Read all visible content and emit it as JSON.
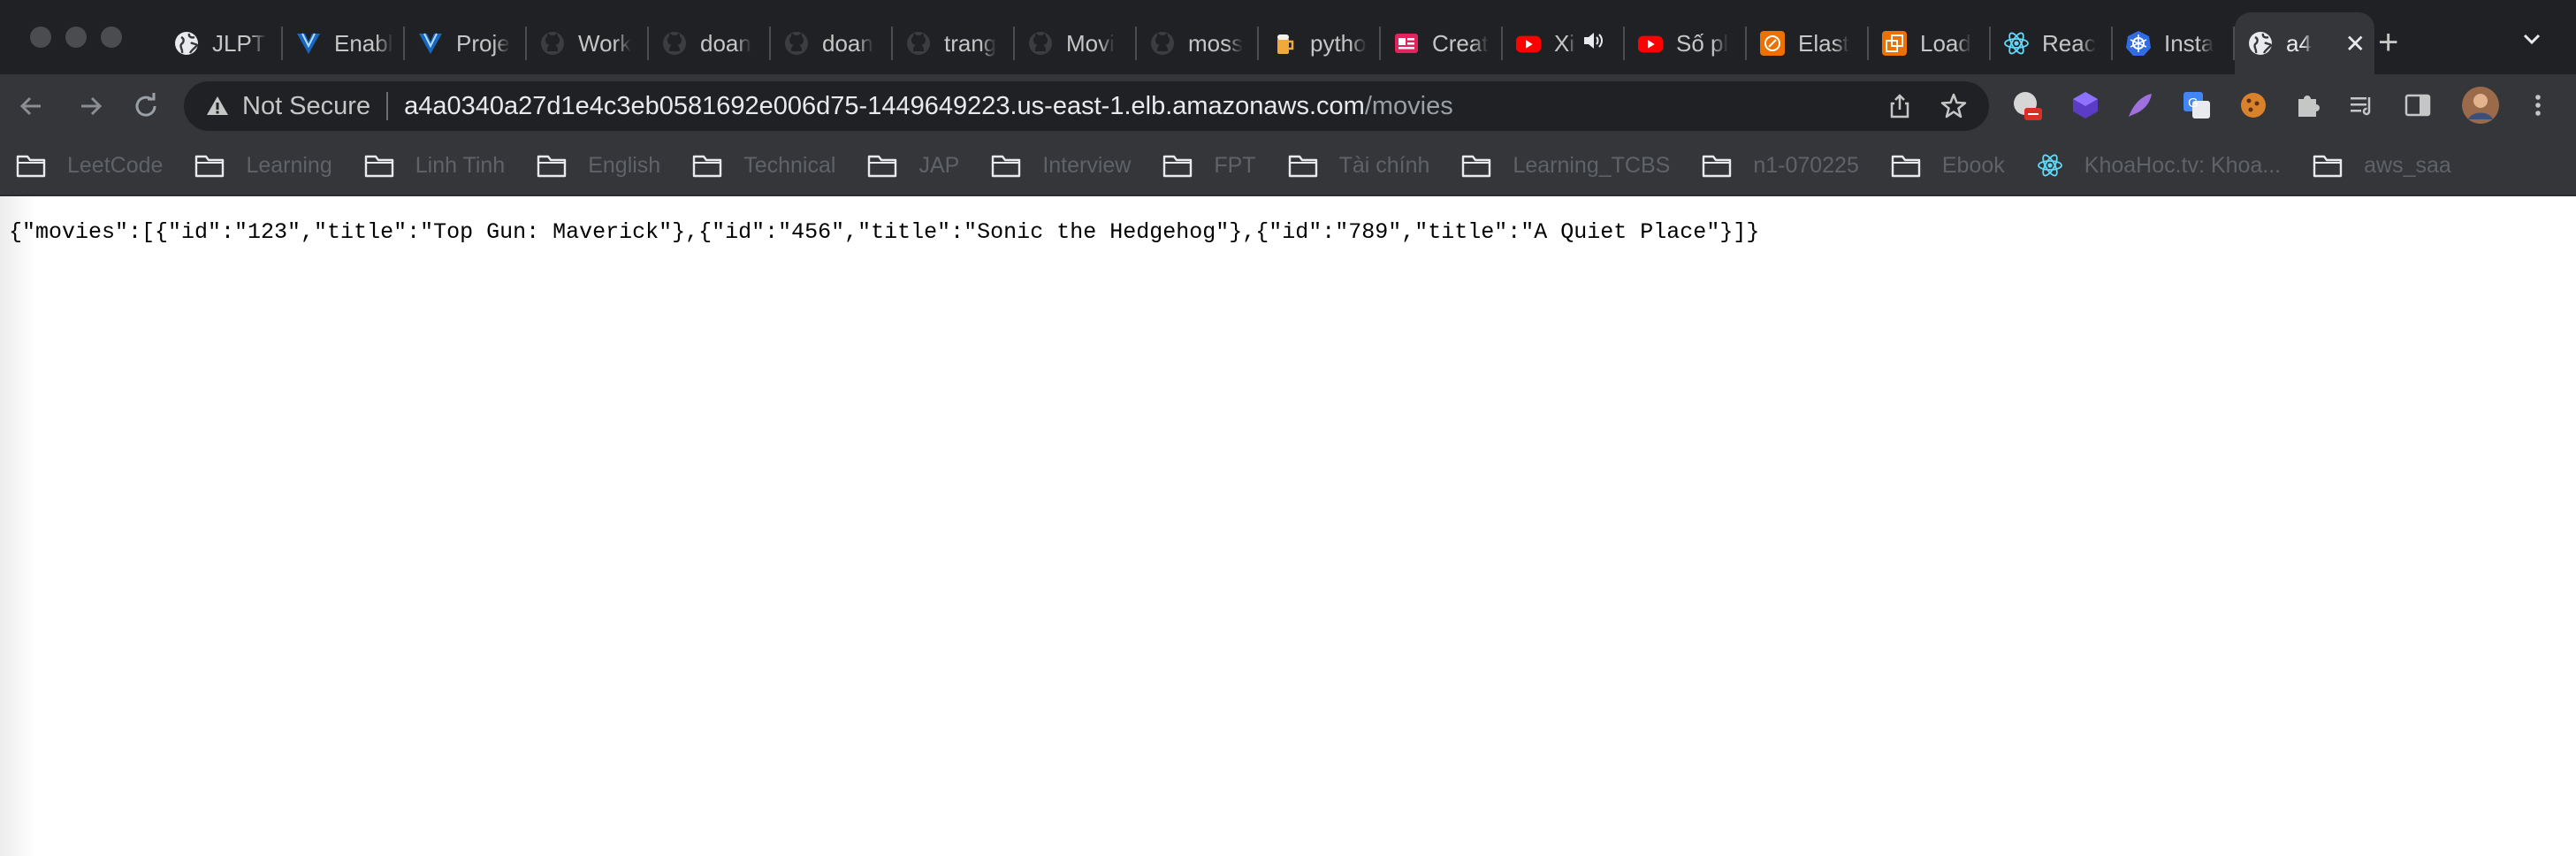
{
  "tabs": [
    {
      "label": "JLPT",
      "icon": "globe-icon"
    },
    {
      "label": "Enabl",
      "icon": "vuetify-icon"
    },
    {
      "label": "Proje",
      "icon": "vuetify-icon"
    },
    {
      "label": "Work",
      "icon": "github-icon"
    },
    {
      "label": "doan",
      "icon": "github-icon"
    },
    {
      "label": "doan",
      "icon": "github-icon"
    },
    {
      "label": "trang",
      "icon": "github-icon"
    },
    {
      "label": "Movi",
      "icon": "github-icon"
    },
    {
      "label": "moss",
      "icon": "github-icon"
    },
    {
      "label": "pytho",
      "icon": "beer-icon"
    },
    {
      "label": "Creat",
      "icon": "form-icon"
    },
    {
      "label": "Xi",
      "icon": "youtube-icon",
      "audio": true
    },
    {
      "label": "Số pl",
      "icon": "youtube-icon"
    },
    {
      "label": "Elast",
      "icon": "aws-elastic-icon"
    },
    {
      "label": "Load",
      "icon": "aws-loadbalancer-icon"
    },
    {
      "label": "Reac",
      "icon": "react-icon"
    },
    {
      "label": "Insta",
      "icon": "kubernetes-icon"
    },
    {
      "label": "a4",
      "icon": "globe-icon",
      "active": true
    }
  ],
  "close_glyph": "✕",
  "new_tab_glyph": "+",
  "address": {
    "security_label": "Not Secure",
    "host": "a4a0340a27d1e4c3eb0581692e006d75-1449649223.us-east-1.elb.amazonaws.com",
    "path": "/movies"
  },
  "bookmarks": [
    {
      "label": "LeetCode",
      "icon": "folder-icon"
    },
    {
      "label": "Learning",
      "icon": "folder-icon"
    },
    {
      "label": "Linh Tinh",
      "icon": "folder-icon"
    },
    {
      "label": "English",
      "icon": "folder-icon"
    },
    {
      "label": "Technical",
      "icon": "folder-icon"
    },
    {
      "label": "JAP",
      "icon": "folder-icon"
    },
    {
      "label": "Interview",
      "icon": "folder-icon"
    },
    {
      "label": "FPT",
      "icon": "folder-icon"
    },
    {
      "label": "Tài chính",
      "icon": "folder-icon"
    },
    {
      "label": "Learning_TCBS",
      "icon": "folder-icon"
    },
    {
      "label": "n1-070225",
      "icon": "folder-icon"
    },
    {
      "label": "Ebook",
      "icon": "folder-icon"
    },
    {
      "label": "KhoaHoc.tv: Khoa...",
      "icon": "react-icon"
    },
    {
      "label": "aws_saa",
      "icon": "folder-icon"
    }
  ],
  "extensions": [
    "adblock-icon",
    "ext-purple-cube-icon",
    "ext-feather-icon",
    "google-translate-icon",
    "cookie-icon",
    "puzzle-extensions-icon",
    "media-control-icon",
    "side-panel-icon",
    "profile-avatar",
    "menu-kebab-icon"
  ],
  "page": {
    "json_text": "{\"movies\":[{\"id\":\"123\",\"title\":\"Top Gun: Maverick\"},{\"id\":\"456\",\"title\":\"Sonic the Hedgehog\"},{\"id\":\"789\",\"title\":\"A Quiet Place\"}]}"
  },
  "colors": {
    "tab_strip": "#202124",
    "toolbar": "#35363a",
    "omnibox": "#202124"
  }
}
